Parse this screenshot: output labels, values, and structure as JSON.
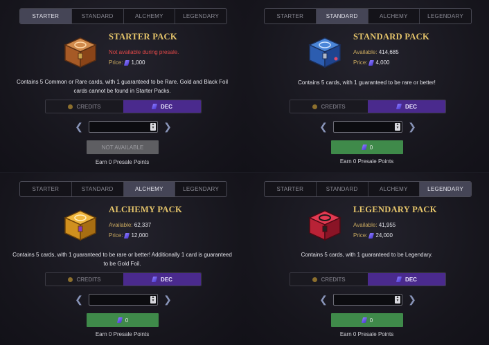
{
  "tabs": [
    "STARTER",
    "STANDARD",
    "ALCHEMY",
    "LEGENDARY"
  ],
  "labels": {
    "credits": "CREDITS",
    "dec": "DEC",
    "available": "Available:",
    "price": "Price:"
  },
  "panels": [
    {
      "active_tab": 0,
      "title": "STARTER PACK",
      "availability_text": "Not available during presale.",
      "available": "",
      "price": "1,000",
      "description": "Contains 5 Common or Rare cards, with 1 guaranteed to be Rare. Gold and Black Foil cards cannot be found in Starter Packs.",
      "button_label": "NOT AVAILABLE",
      "points": "Earn 0 Presale Points",
      "chest_color": "#b86a34"
    },
    {
      "active_tab": 1,
      "title": "STANDARD PACK",
      "availability_text": "",
      "available": "414,685",
      "price": "4,000",
      "description": "Contains 5 cards, with 1 guaranteed to be rare or better!",
      "button_label": "0",
      "points": "Earn 0 Presale Points",
      "chest_color": "#2e63b8"
    },
    {
      "active_tab": 2,
      "title": "ALCHEMY PACK",
      "availability_text": "",
      "available": "62,337",
      "price": "12,000",
      "description": "Contains 5 cards, with 1 guaranteed to be rare or better! Additionally 1 card is guaranteed to be Gold Foil.",
      "button_label": "0",
      "points": "Earn 0 Presale Points",
      "chest_color": "#d69a2a"
    },
    {
      "active_tab": 3,
      "title": "LEGENDARY PACK",
      "availability_text": "",
      "available": "41,955",
      "price": "24,000",
      "description": "Contains 5 cards, with 1 guaranteed to be Legendary.",
      "button_label": "0",
      "points": "Earn 0 Presale Points",
      "chest_color": "#c5263e"
    }
  ]
}
